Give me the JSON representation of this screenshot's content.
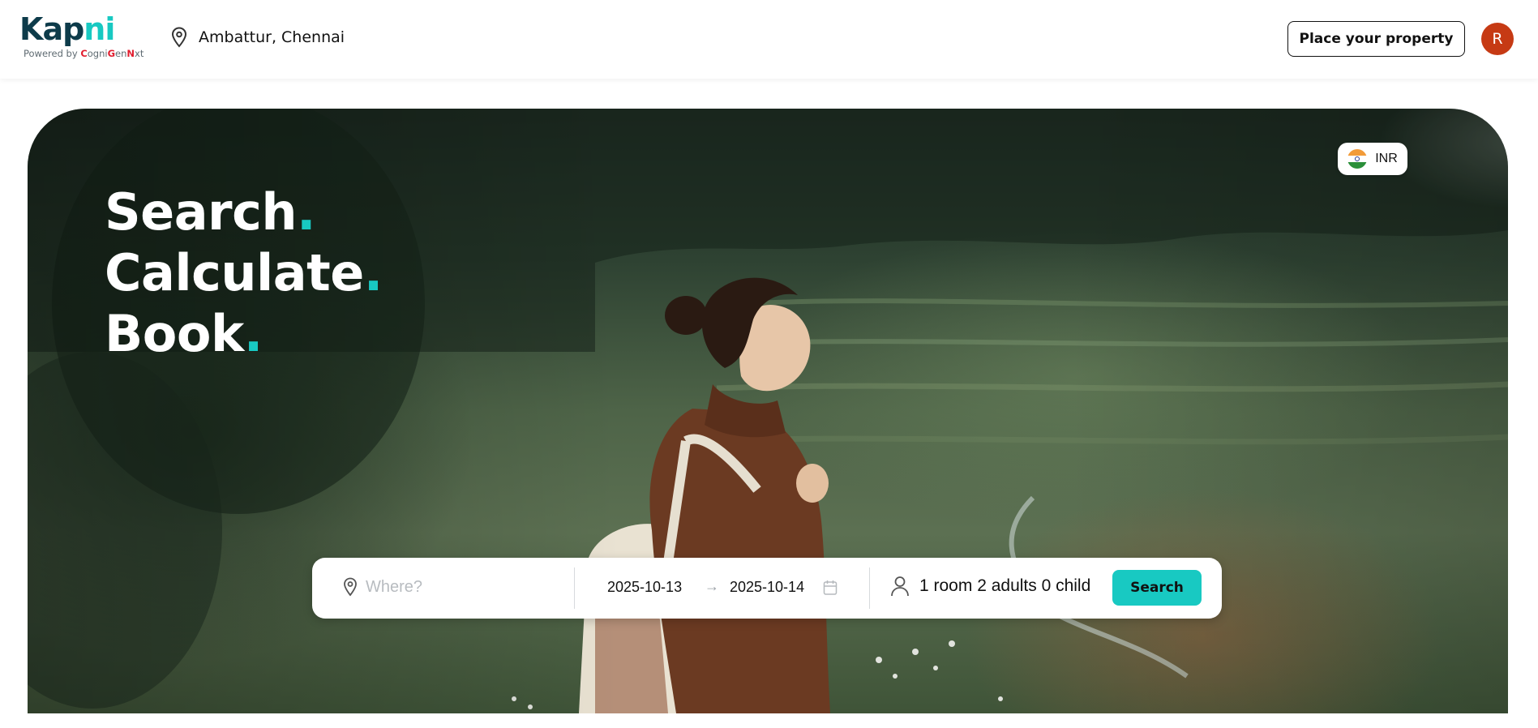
{
  "brand": {
    "logo_part1": "Kap",
    "logo_part2": "ni",
    "powered_prefix": "Powered by ",
    "powered_letters": [
      "C",
      "ogni",
      "G",
      "en",
      "N",
      "xt"
    ]
  },
  "header": {
    "location": "Ambattur, Chennai",
    "place_property_label": "Place your property",
    "avatar_initial": "R"
  },
  "hero": {
    "currency": "INR",
    "tagline": [
      {
        "word": "Search",
        "dot": "."
      },
      {
        "word": "Calculate",
        "dot": "."
      },
      {
        "word": "Book",
        "dot": "."
      }
    ]
  },
  "search": {
    "where_placeholder": "Where?",
    "checkin": "2025-10-13",
    "checkout": "2025-10-14",
    "arrow": "→",
    "guests": "1 room 2 adults 0 child",
    "button_label": "Search"
  },
  "colors": {
    "accent": "#18c9c2",
    "logo_dark": "#0d3b4a",
    "avatar": "#c63a14",
    "powered_red": "#e11d2e"
  },
  "icons": [
    "location-pin-icon",
    "india-flag-icon",
    "where-pin-icon",
    "arrow-right-icon",
    "calendar-icon",
    "person-icon"
  ]
}
